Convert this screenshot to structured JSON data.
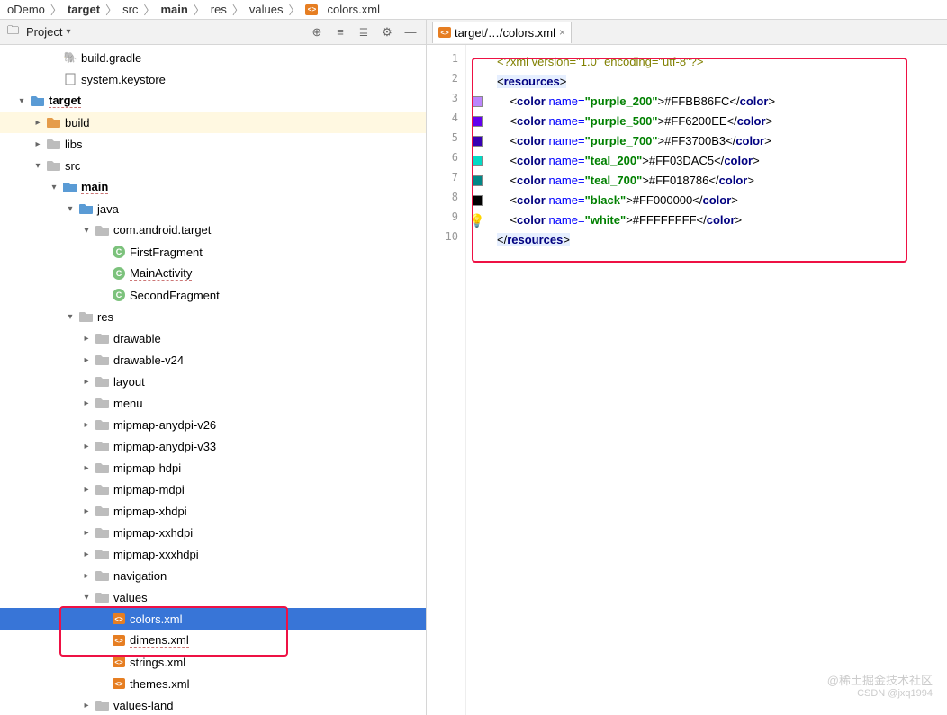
{
  "breadcrumb": [
    "oDemo",
    "target",
    "src",
    "main",
    "res",
    "values",
    "colors.xml"
  ],
  "panel": {
    "title": "Project"
  },
  "tree": {
    "items": [
      {
        "depth": 2,
        "label": "build.gradle",
        "iconType": "gradle"
      },
      {
        "depth": 2,
        "label": "system.keystore",
        "iconType": "file"
      },
      {
        "depth": 0,
        "label": "target",
        "arrow": "down",
        "iconType": "folder-blue",
        "bold": true,
        "underline": true
      },
      {
        "depth": 1,
        "label": "build",
        "arrow": "right",
        "iconType": "folder-orange",
        "highlight": true
      },
      {
        "depth": 1,
        "label": "libs",
        "arrow": "right",
        "iconType": "folder"
      },
      {
        "depth": 1,
        "label": "src",
        "arrow": "down",
        "iconType": "folder"
      },
      {
        "depth": 2,
        "label": "main",
        "arrow": "down",
        "iconType": "folder-blue",
        "bold": true,
        "underline": true
      },
      {
        "depth": 3,
        "label": "java",
        "arrow": "down",
        "iconType": "folder-blue"
      },
      {
        "depth": 4,
        "label": "com.android.target",
        "arrow": "down",
        "iconType": "folder",
        "underline": true
      },
      {
        "depth": 5,
        "label": "FirstFragment",
        "iconType": "class"
      },
      {
        "depth": 5,
        "label": "MainActivity",
        "iconType": "class",
        "underline": true
      },
      {
        "depth": 5,
        "label": "SecondFragment",
        "iconType": "class"
      },
      {
        "depth": 3,
        "label": "res",
        "arrow": "down",
        "iconType": "folder"
      },
      {
        "depth": 4,
        "label": "drawable",
        "arrow": "right",
        "iconType": "folder"
      },
      {
        "depth": 4,
        "label": "drawable-v24",
        "arrow": "right",
        "iconType": "folder"
      },
      {
        "depth": 4,
        "label": "layout",
        "arrow": "right",
        "iconType": "folder"
      },
      {
        "depth": 4,
        "label": "menu",
        "arrow": "right",
        "iconType": "folder"
      },
      {
        "depth": 4,
        "label": "mipmap-anydpi-v26",
        "arrow": "right",
        "iconType": "folder"
      },
      {
        "depth": 4,
        "label": "mipmap-anydpi-v33",
        "arrow": "right",
        "iconType": "folder"
      },
      {
        "depth": 4,
        "label": "mipmap-hdpi",
        "arrow": "right",
        "iconType": "folder"
      },
      {
        "depth": 4,
        "label": "mipmap-mdpi",
        "arrow": "right",
        "iconType": "folder"
      },
      {
        "depth": 4,
        "label": "mipmap-xhdpi",
        "arrow": "right",
        "iconType": "folder"
      },
      {
        "depth": 4,
        "label": "mipmap-xxhdpi",
        "arrow": "right",
        "iconType": "folder"
      },
      {
        "depth": 4,
        "label": "mipmap-xxxhdpi",
        "arrow": "right",
        "iconType": "folder"
      },
      {
        "depth": 4,
        "label": "navigation",
        "arrow": "right",
        "iconType": "folder"
      },
      {
        "depth": 4,
        "label": "values",
        "arrow": "down",
        "iconType": "folder"
      },
      {
        "depth": 5,
        "label": "colors.xml",
        "iconType": "xml",
        "selected": true
      },
      {
        "depth": 5,
        "label": "dimens.xml",
        "iconType": "xml",
        "underline": true
      },
      {
        "depth": 5,
        "label": "strings.xml",
        "iconType": "xml"
      },
      {
        "depth": 5,
        "label": "themes.xml",
        "iconType": "xml"
      },
      {
        "depth": 4,
        "label": "values-land",
        "arrow": "right",
        "iconType": "folder"
      }
    ]
  },
  "tab": {
    "label": "target/…/colors.xml"
  },
  "code": {
    "lines": [
      {
        "type": "decl",
        "text": "<?xml version=\"1.0\" encoding=\"utf-8\"?>"
      },
      {
        "type": "openroot",
        "tag": "resources",
        "hl": true
      },
      {
        "type": "color",
        "name": "purple_200",
        "value": "#FFBB86FC",
        "swatch": "#BB86FC"
      },
      {
        "type": "color",
        "name": "purple_500",
        "value": "#FF6200EE",
        "swatch": "#6200EE"
      },
      {
        "type": "color",
        "name": "purple_700",
        "value": "#FF3700B3",
        "swatch": "#3700B3"
      },
      {
        "type": "color",
        "name": "teal_200",
        "value": "#FF03DAC5",
        "swatch": "#03DAC5"
      },
      {
        "type": "color",
        "name": "teal_700",
        "value": "#FF018786",
        "swatch": "#018786"
      },
      {
        "type": "color",
        "name": "black",
        "value": "#FF000000",
        "swatch": "#000000"
      },
      {
        "type": "color",
        "name": "white",
        "value": "#FFFFFFFF",
        "swatch": "#FFFFFF",
        "bulb": true
      },
      {
        "type": "closeroot",
        "tag": "resources",
        "hl": true
      }
    ]
  },
  "watermark": {
    "main": "@稀土掘金技术社区",
    "sub": "CSDN @jxq1994"
  }
}
